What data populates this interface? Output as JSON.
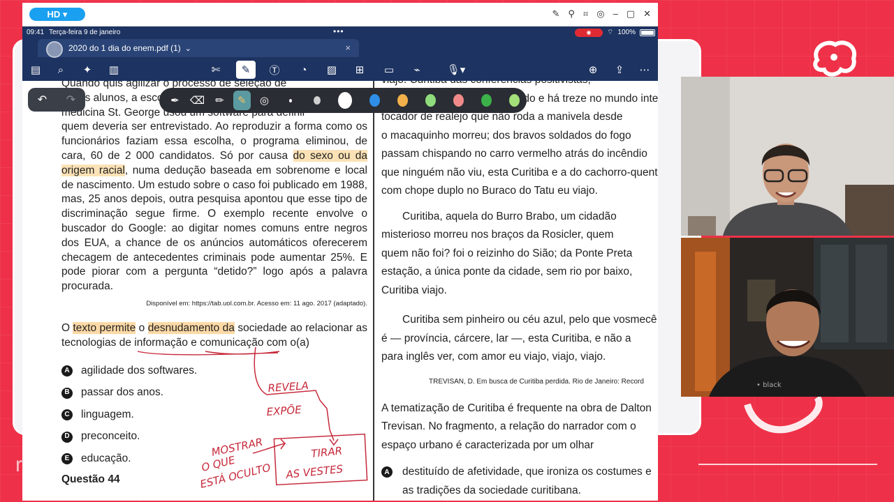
{
  "window": {
    "quality_badge": "HD ▾"
  },
  "status_bar": {
    "time": "09:41",
    "date": "Terça-feira 9 de janeiro",
    "battery": "100%"
  },
  "tab": {
    "title": "2020 do 1 dia do enem.pdf (1)",
    "chevron": "⌄",
    "close": "×"
  },
  "left_column": {
    "lines_top": [
      "Quando quis agilizar o processo de seleção de",
      "novos alunos, a escola de medicina",
      "medicina St. George usou um software para definir"
    ],
    "paragraph_1a": "quem deveria ser entrevistado. Ao reproduzir a forma como os funcionários faziam essa escolha, o programa eliminou, de cara, 60 de 2 000 candidatos. Só por causa ",
    "highlight_1": "do sexo ou da origem racial",
    "paragraph_1b": ", numa dedução baseada em sobrenome e local de nascimento. Um estudo sobre o caso foi publicado em 1988, mas, 25 anos depois, outra pesquisa apontou que esse tipo de discriminação segue firme. O exemplo recente envolve o buscador do Google: ao digitar nomes comuns entre negros dos EUA, a chance de os anúncios automáticos oferecerem checagem de antecedentes criminais pode aumentar 25%. E pode piorar com a pergunta “detido?” logo após a palavra procurada.",
    "source": "Disponível em: https://tab.uol.com.br. Acesso em: 11 ago. 2017 (adaptado).",
    "stem_a": "O ",
    "stem_hl_1": "texto permite",
    "stem_b": " o ",
    "stem_hl_2": "desnudamento da",
    "stem_c": " sociedade ao relacionar as tecnologias de informação e comunicação com o(a)",
    "options": [
      {
        "letter": "A",
        "text": "agilidade dos softwares."
      },
      {
        "letter": "B",
        "text": "passar dos anos."
      },
      {
        "letter": "C",
        "text": "linguagem."
      },
      {
        "letter": "D",
        "text": "preconceito."
      },
      {
        "letter": "E",
        "text": "educação."
      }
    ],
    "next_question": "Questão 44"
  },
  "right_column": {
    "lines_top": [
      "viajo. Curitiba das conferências positivistas,",
      "eles são onze em todo o mundo e há treze no mundo inteiro,",
      "tocador de realejo que não roda a manivela desde",
      "o macaquinho morreu; dos bravos soldados do fogo",
      "passam chispando no carro vermelho atrás do incêndio",
      "que ninguém não viu, esta Curitiba e a do cachorro-quente",
      "com chope duplo no Buraco do Tatu eu viajo."
    ],
    "par_2": [
      "Curitiba, aquela do Burro Brabo, um cidadão",
      "misterioso morreu nos braços da Rosicler, quem",
      "quem não foi? foi o reizinho do Sião; da Ponte Preta",
      "estação, a única ponte da cidade, sem rio por baixo,",
      "Curitiba viajo."
    ],
    "par_3": [
      "Curitiba sem pinheiro ou céu azul, pelo que vosmecê",
      "é — província, cárcere, lar —, esta Curitiba, e não a",
      "para inglês ver, com amor eu viajo, viajo, viajo."
    ],
    "reference": "TREVISAN, D. Em busca de Curitiba perdida. Rio de Janeiro: Record",
    "question": [
      "A tematização de Curitiba é frequente na obra de Dalton",
      "Trevisan. No fragmento, a relação do narrador com o",
      "espaço urbano é caracterizada por um olhar"
    ],
    "option_a": [
      "destituído de afetividade, que ironiza os costumes e",
      "as tradições da sociedade curitibana."
    ],
    "option_a_letter": "A"
  },
  "handwriting": {
    "a": "REVELA",
    "b": "EXPÕE",
    "c": "MOSTRAR",
    "d": "O QUE",
    "e": "ESTÁ OCULTO",
    "f": "TIRAR",
    "g": "AS VESTES"
  },
  "colors": {
    "accent_red": "#ee3148",
    "toolbar_navy": "#1d3361",
    "highlight": "#fbe2b6",
    "ink_red": "#c6293a",
    "swatches": [
      "#ffffff",
      "#2f8fe8",
      "#f2b14a",
      "#8fdc7c",
      "#f08a8a",
      "#3cb14a",
      "#a4e07a"
    ]
  }
}
